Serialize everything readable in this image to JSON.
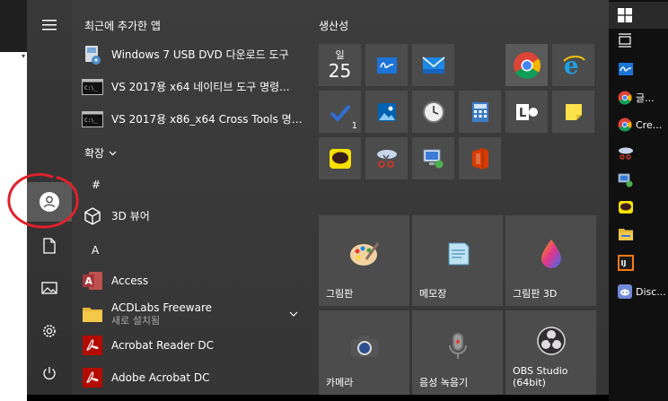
{
  "recent_header": "최근에 추가한 앱",
  "expand_label": "확장",
  "recent_apps": [
    {
      "label": "Windows 7 USB DVD 다운로드 도구",
      "icon": "usb-tool-icon"
    },
    {
      "label": "VS 2017용 x64 네이티브 도구 명령...",
      "icon": "cmd-icon"
    },
    {
      "label": "VS 2017용 x86_x64 Cross Tools 명령...",
      "icon": "cmd-icon"
    }
  ],
  "letters": {
    "hash": "#",
    "a": "A"
  },
  "apps": [
    {
      "label": "3D 뷰어",
      "icon": "cube-3d-icon"
    },
    {
      "label": "Access",
      "icon": "access-icon"
    },
    {
      "label": "ACDLabs Freeware",
      "sub": "새로 설치됨",
      "icon": "folder-icon"
    },
    {
      "label": "Acrobat Reader DC",
      "icon": "acrobat-icon"
    },
    {
      "label": "Adobe Acrobat DC",
      "icon": "acrobat-icon"
    }
  ],
  "tiles": {
    "group_title": "생산성",
    "calendar": {
      "day_name": "일",
      "day_num": "25"
    },
    "mail_badge": "1",
    "big": [
      {
        "label": "그림판"
      },
      {
        "label": "메모장"
      },
      {
        "label": "그림판 3D"
      },
      {
        "label": "카메라"
      },
      {
        "label": "음성 녹음기"
      },
      {
        "label": "OBS Studio\n(64bit)"
      }
    ]
  },
  "taskbar": [
    {
      "label": "",
      "icon": "windows-icon"
    },
    {
      "label": "",
      "icon": "task-view-icon"
    },
    {
      "label": "",
      "icon": "whiteboard-icon"
    },
    {
      "label": "글...",
      "icon": "chrome-icon"
    },
    {
      "label": "Cre...",
      "icon": "chrome-icon"
    },
    {
      "label": "",
      "icon": "tool-icon"
    },
    {
      "label": "",
      "icon": "network-icon"
    },
    {
      "label": "",
      "icon": "kakaotalk-icon"
    },
    {
      "label": "",
      "icon": "file-explorer-icon"
    },
    {
      "label": "",
      "icon": "intellij-icon"
    },
    {
      "label": "Disc...",
      "icon": "discord-icon"
    }
  ],
  "colors": {
    "accent_red": "#e0212b",
    "tile_bg": "#4c4c4c",
    "menu_bg": "#3b3b3b"
  }
}
